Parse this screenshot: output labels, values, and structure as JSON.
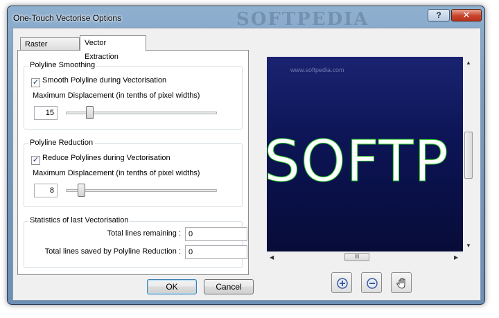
{
  "window": {
    "title": "One-Touch Vectorise Options",
    "watermark": "SOFTPEDIA",
    "help_label": "?",
    "close_label": "✕"
  },
  "tabs": [
    {
      "label": "Raster Thinning",
      "active": false
    },
    {
      "label": "Vector Extraction",
      "active": true
    }
  ],
  "smoothing": {
    "legend": "Polyline Smoothing",
    "checkbox_label": "Smooth Polyline during Vectorisation",
    "checked": true,
    "displacement_label": "Maximum Displacement (in tenths of pixel widths)",
    "value": "15",
    "slider_fraction": 0.14
  },
  "reduction": {
    "legend": "Polyline Reduction",
    "checkbox_label": "Reduce Polylines during Vectorisation",
    "checked": true,
    "displacement_label": "Maximum Displacement (in tenths of pixel widths)",
    "value": "8",
    "slider_fraction": 0.08
  },
  "statistics": {
    "legend": "Statistics of last Vectorisation",
    "remaining_label": "Total lines remaining :",
    "remaining_value": "0",
    "saved_label": "Total lines saved by Polyline Reduction :",
    "saved_value": "0"
  },
  "buttons": {
    "ok": "OK",
    "cancel": "Cancel"
  },
  "preview": {
    "watermark": "www.softpedia.com",
    "text": "SOFTP",
    "hscroll_grip": "III"
  },
  "icons": {
    "zoom_in": "zoom-in-icon",
    "zoom_out": "zoom-out-icon",
    "pan": "hand-pan-icon"
  },
  "colors": {
    "outline": "#28d028",
    "canvas_bg": "#0c1454"
  }
}
